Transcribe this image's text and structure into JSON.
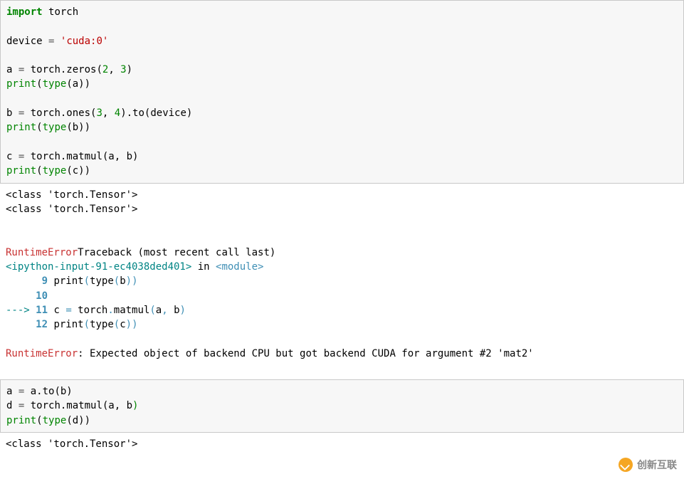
{
  "cell1": {
    "l1": {
      "kw": "import",
      "sp": " ",
      "mod": "torch"
    },
    "blank1": "",
    "l2": {
      "pre": "device ",
      "op": "=",
      "sp": " ",
      "str": "'cuda:0'"
    },
    "blank2": "",
    "l3": {
      "pre": "a ",
      "op": "=",
      "mid": " torch.zeros(",
      "n1": "2",
      "c1": ", ",
      "n2": "3",
      "end": ")"
    },
    "l4": {
      "fn": "print",
      "p1": "(",
      "fn2": "type",
      "p2": "(a))"
    },
    "blank3": "",
    "l5": {
      "pre": "b ",
      "op": "=",
      "mid": " torch.ones(",
      "n1": "3",
      "c1": ", ",
      "n2": "4",
      "mid2": ").to(device)"
    },
    "l6": {
      "fn": "print",
      "p1": "(",
      "fn2": "type",
      "p2": "(b))"
    },
    "blank4": "",
    "l7": {
      "pre": "c ",
      "op": "=",
      "mid": " torch.matmul(a, b)"
    },
    "l8": {
      "fn": "print",
      "p1": "(",
      "fn2": "type",
      "p2": "(c))"
    }
  },
  "out1": {
    "o1": "<class 'torch.Tensor'>",
    "o2": "<class 'torch.Tensor'>",
    "blank1": "",
    "blank2": "",
    "tb1": {
      "name": "RuntimeError",
      "rest": "Traceback (most recent call last)"
    },
    "tb2": {
      "file": "<ipython-input-91-ec4038ded401>",
      "in": " in ",
      "mod": "<module>"
    },
    "tb3": {
      "pad": "      ",
      "ln": "9",
      "sp": " ",
      "fn": "print",
      "p1": "(",
      "fn2": "type",
      "p2": "(",
      "arg": "b",
      "p3": ")",
      ")": ")"
    },
    "tb4": {
      "pad": "     ",
      "ln": "10"
    },
    "tb5": {
      "arrow": "---> ",
      "ln": "11",
      "sp": " ",
      "code1": "c ",
      "eq": "=",
      "code2": " torch",
      "dot": ".",
      "code3": "matmul",
      "p1": "(",
      "a": "a",
      "c1": ",",
      "sp2": " ",
      "b": "b",
      "p2": ")"
    },
    "tb6": {
      "pad": "     ",
      "ln": "12",
      "sp": " ",
      "fn": "print",
      "p1": "(",
      "fn2": "type",
      "p2": "(",
      "arg": "c",
      "p3": ")",
      ")": ")"
    },
    "blank3": "",
    "err": {
      "name": "RuntimeError",
      "colon": ": ",
      "msg": "Expected object of backend CPU but got backend CUDA for argument #2 'mat2'"
    }
  },
  "cell2": {
    "l1": {
      "pre": "a ",
      "op": "=",
      "mid": " a.to(b)"
    },
    "l2": {
      "pre": "d ",
      "op": "=",
      "mid": " torch.matmul(a, b",
      ")": ")"
    },
    "l3": {
      "fn": "print",
      "p1": "(",
      "fn2": "type",
      "p2": "(d))"
    }
  },
  "out2": {
    "o1": "<class 'torch.Tensor'>"
  },
  "watermark": {
    "text": "创新互联"
  },
  "chart_data": {
    "type": "table",
    "title": "Jupyter code cells and output (PyTorch tensor device example)",
    "cells": [
      {
        "kind": "code",
        "source": "import torch\n\ndevice = 'cuda:0'\n\na = torch.zeros(2, 3)\nprint(type(a))\n\nb = torch.ones(3, 4).to(device)\nprint(type(b))\n\nc = torch.matmul(a, b)\nprint(type(c))",
        "stdout": "<class 'torch.Tensor'>\n<class 'torch.Tensor'>",
        "error": {
          "ename": "RuntimeError",
          "traceback_header": "RuntimeErrorTraceback (most recent call last)",
          "location": "<ipython-input-91-ec4038ded401> in <module>",
          "context": [
            "      9 print(type(b))",
            "     10",
            "---> 11 c = torch.matmul(a, b)",
            "     12 print(type(c))"
          ],
          "evalue": "Expected object of backend CPU but got backend CUDA for argument #2 'mat2'"
        }
      },
      {
        "kind": "code",
        "source": "a = a.to(b)\nd = torch.matmul(a, b)\nprint(type(d))",
        "stdout": "<class 'torch.Tensor'>"
      }
    ]
  }
}
